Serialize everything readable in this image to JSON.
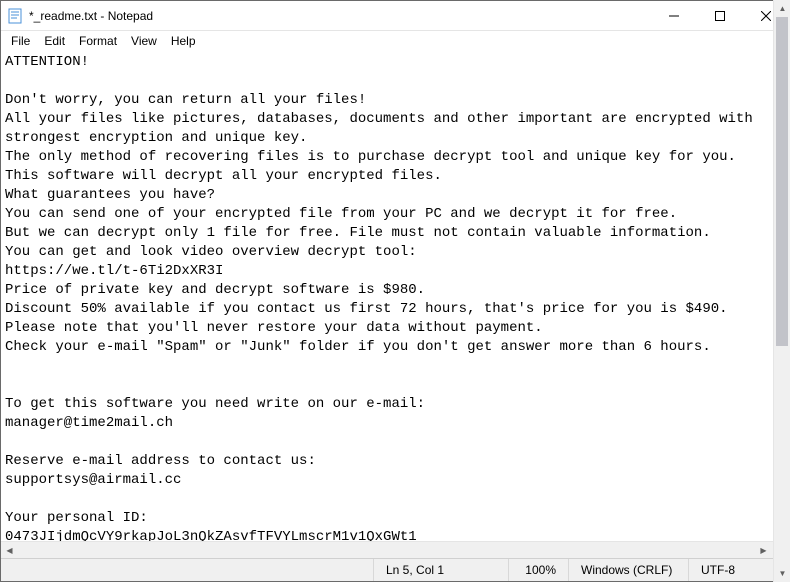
{
  "window": {
    "title": "*_readme.txt - Notepad"
  },
  "menu": {
    "file": "File",
    "edit": "Edit",
    "format": "Format",
    "view": "View",
    "help": "Help"
  },
  "content": {
    "text": "ATTENTION!\n\nDon't worry, you can return all your files!\nAll your files like pictures, databases, documents and other important are encrypted with strongest encryption and unique key.\nThe only method of recovering files is to purchase decrypt tool and unique key for you.\nThis software will decrypt all your encrypted files.\nWhat guarantees you have?\nYou can send one of your encrypted file from your PC and we decrypt it for free.\nBut we can decrypt only 1 file for free. File must not contain valuable information.\nYou can get and look video overview decrypt tool:\nhttps://we.tl/t-6Ti2DxXR3I\nPrice of private key and decrypt software is $980.\nDiscount 50% available if you contact us first 72 hours, that's price for you is $490.\nPlease note that you'll never restore your data without payment.\nCheck your e-mail \"Spam\" or \"Junk\" folder if you don't get answer more than 6 hours.\n\n\nTo get this software you need write on our e-mail:\nmanager@time2mail.ch\n\nReserve e-mail address to contact us:\nsupportsys@airmail.cc\n\nYour personal ID:\n0473JIjdmQcVY9rkapJoL3nQkZAsvfTFVYLmscrM1v1QxGWt1"
  },
  "status": {
    "position": "Ln 5, Col 1",
    "zoom": "100%",
    "line_ending": "Windows (CRLF)",
    "encoding": "UTF-8"
  }
}
